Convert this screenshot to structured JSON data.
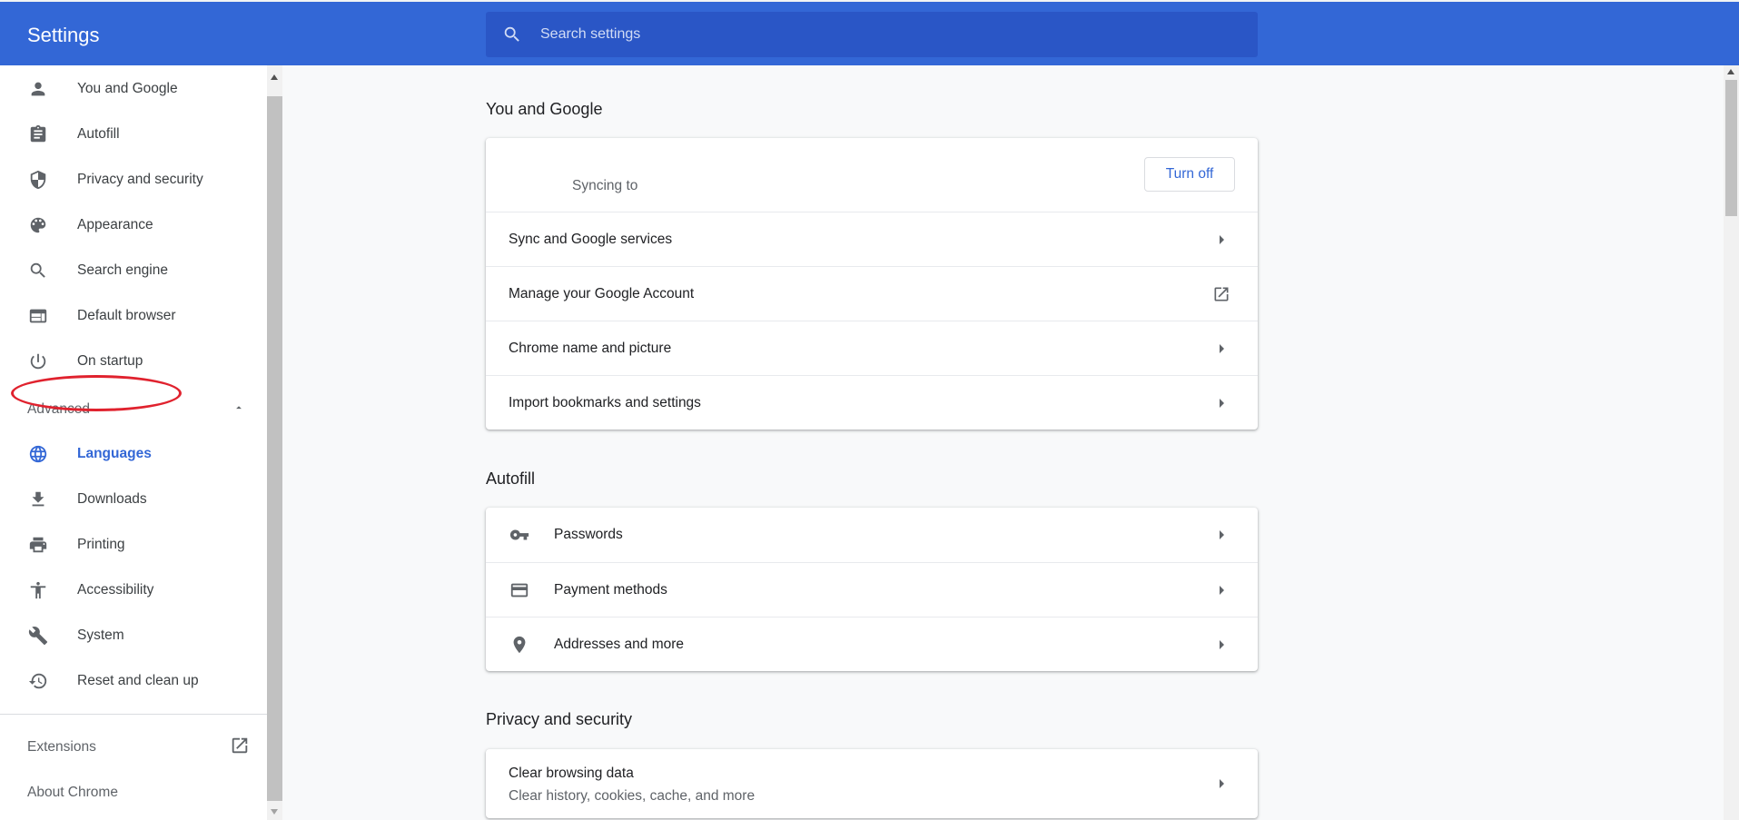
{
  "header": {
    "title": "Settings",
    "search_placeholder": "Search settings"
  },
  "sidebar": {
    "items": [
      {
        "label": "You and Google",
        "icon": "person-icon"
      },
      {
        "label": "Autofill",
        "icon": "clipboard-icon"
      },
      {
        "label": "Privacy and security",
        "icon": "shield-icon"
      },
      {
        "label": "Appearance",
        "icon": "palette-icon"
      },
      {
        "label": "Search engine",
        "icon": "search-icon"
      },
      {
        "label": "Default browser",
        "icon": "browser-window-icon"
      },
      {
        "label": "On startup",
        "icon": "power-icon"
      }
    ],
    "advanced_label": "Advanced",
    "advanced_items": [
      {
        "label": "Languages",
        "icon": "globe-icon",
        "active": true
      },
      {
        "label": "Downloads",
        "icon": "download-icon"
      },
      {
        "label": "Printing",
        "icon": "printer-icon"
      },
      {
        "label": "Accessibility",
        "icon": "accessibility-icon"
      },
      {
        "label": "System",
        "icon": "wrench-icon"
      },
      {
        "label": "Reset and clean up",
        "icon": "restore-icon"
      }
    ],
    "extensions_label": "Extensions",
    "about_label": "About Chrome"
  },
  "main": {
    "you_and_google": {
      "title": "You and Google",
      "sync_text": "Syncing to",
      "turn_off_label": "Turn off",
      "rows": [
        "Sync and Google services",
        "Manage your Google Account",
        "Chrome name and picture",
        "Import bookmarks and settings"
      ]
    },
    "autofill": {
      "title": "Autofill",
      "rows": [
        "Passwords",
        "Payment methods",
        "Addresses and more"
      ]
    },
    "privacy": {
      "title": "Privacy and security",
      "clear_title": "Clear browsing data",
      "clear_sub": "Clear history, cookies, cache, and more"
    }
  },
  "colors": {
    "header": "#3367d6",
    "search": "#2a56c6",
    "accent": "#3367d6",
    "highlight_ring": "#e0222e"
  }
}
